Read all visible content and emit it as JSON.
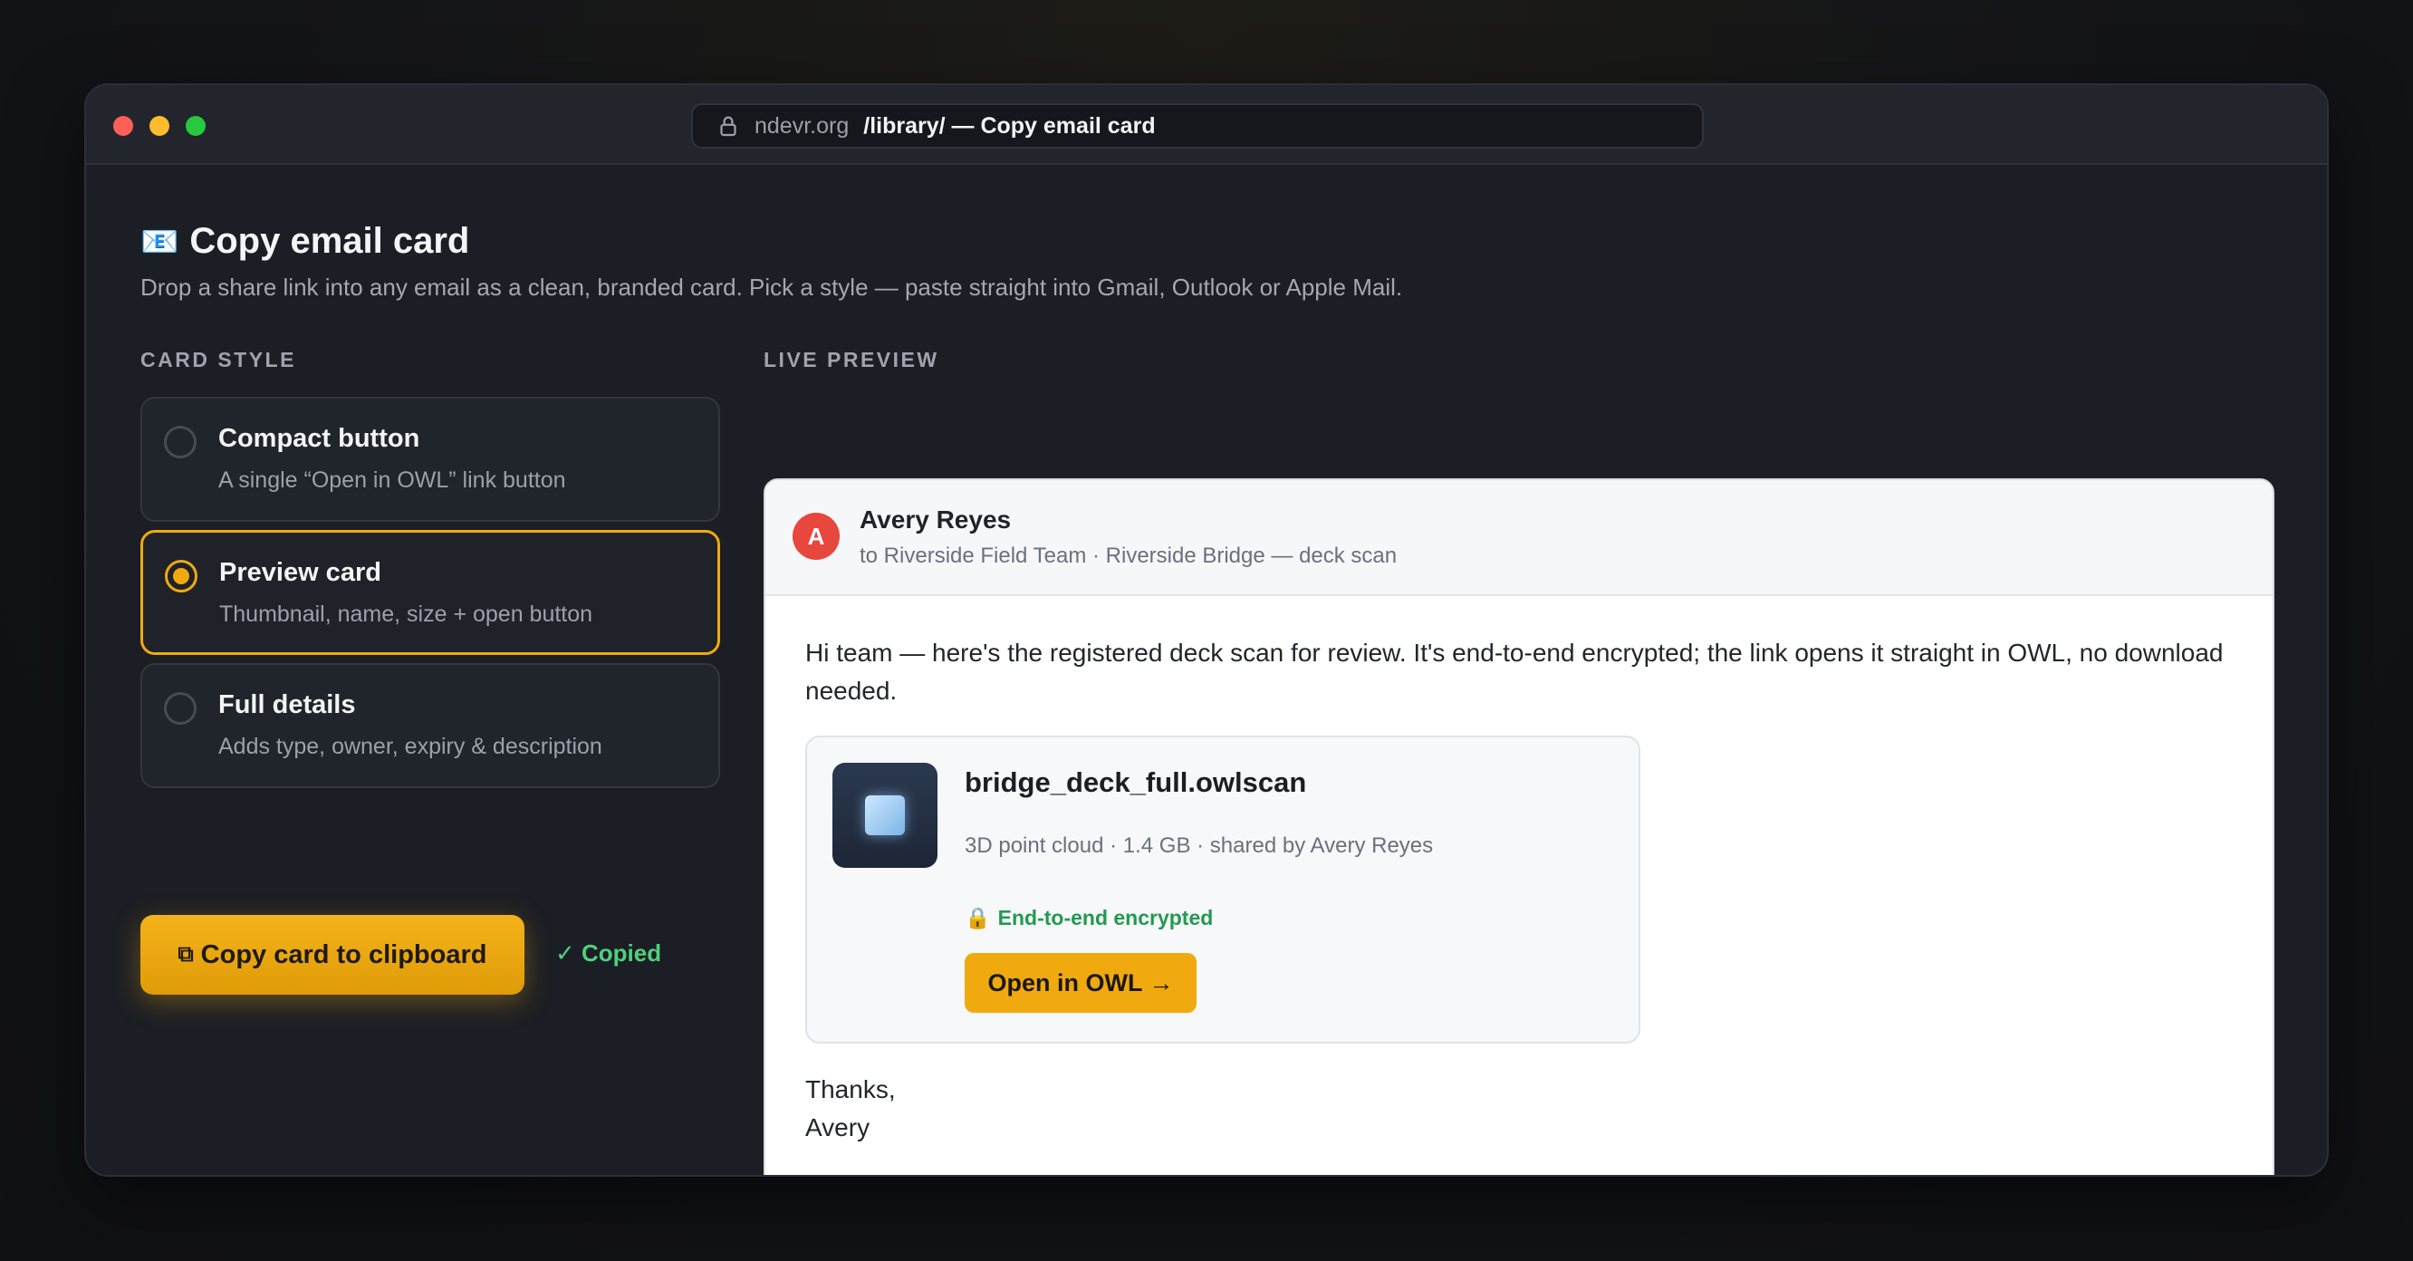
{
  "window": {
    "url_host": "ndevr.org",
    "url_path": "/library/ — Copy email card"
  },
  "page": {
    "emoji": "📧",
    "title": "Copy email card",
    "subtitle": "Drop a share link into any email as a clean, branded card. Pick a style — paste straight into Gmail, Outlook or Apple Mail."
  },
  "card_style": {
    "label": "CARD STYLE",
    "options": [
      {
        "name": "Compact button",
        "desc": "A single “Open in OWL” link button",
        "selected": false
      },
      {
        "name": "Preview card",
        "desc": "Thumbnail, name, size + open button",
        "selected": true
      },
      {
        "name": "Full details",
        "desc": "Adds type, owner, expiry & description",
        "selected": false
      }
    ],
    "copy_button": "Copy card to clipboard",
    "copy_icon": "⧉",
    "copied_status": "✓ Copied"
  },
  "preview": {
    "label": "LIVE PREVIEW",
    "avatar_letter": "A",
    "sender": "Avery Reyes",
    "recipients": "to Riverside Field Team · Riverside Bridge — deck scan",
    "body": "Hi team — here's the registered deck scan for review. It's end-to-end encrypted; the link opens it straight in OWL, no download needed.",
    "file": {
      "name": "bridge_deck_full.owlscan",
      "meta": "3D point cloud · 1.4 GB · shared by Avery Reyes",
      "encryption": "End-to-end encrypted",
      "open_button": "Open in OWL →"
    },
    "sign_off_1": "Thanks,",
    "sign_off_2": "Avery"
  },
  "colors": {
    "accent": "#f0aa0f",
    "success": "#4fd07e",
    "avatar": "#e7473c"
  }
}
